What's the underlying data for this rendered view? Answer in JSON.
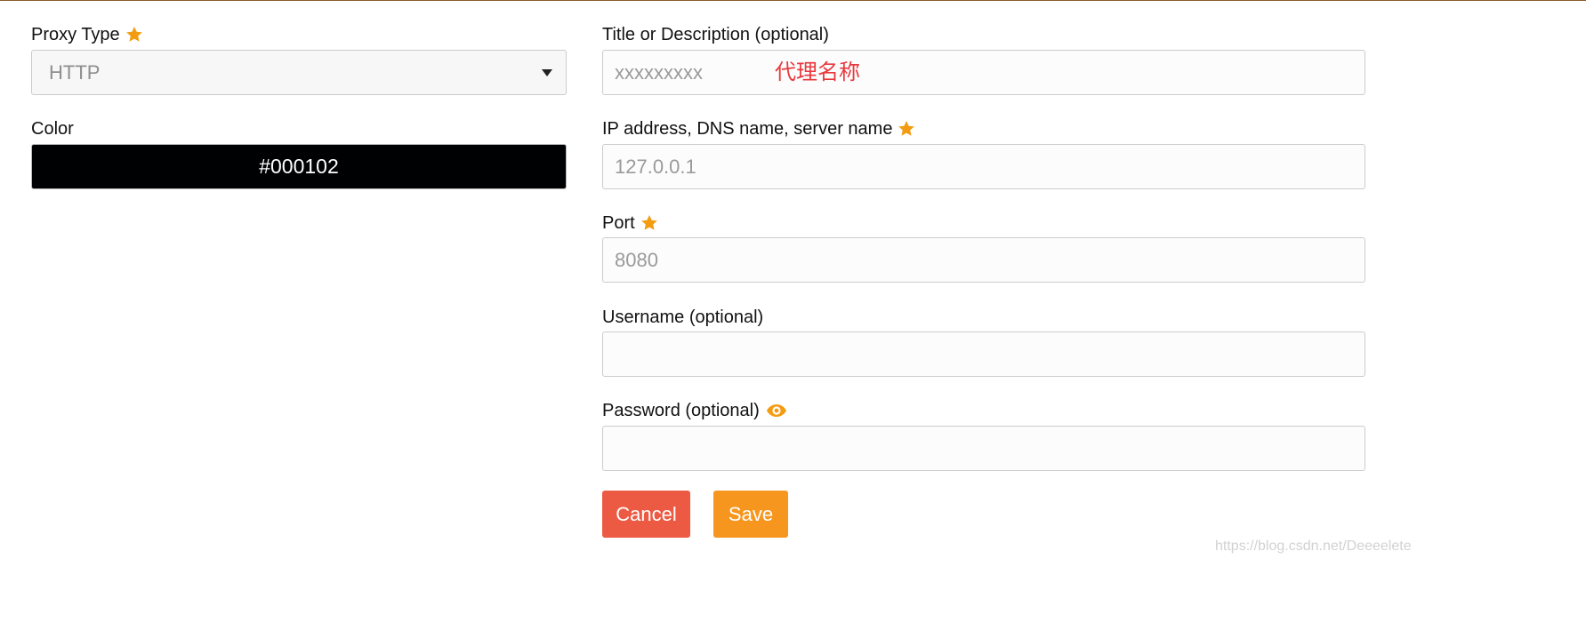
{
  "colors": {
    "required_star": "#f39c12",
    "cancel_button_bg": "#ec5a43",
    "save_button_bg": "#f7961e",
    "annotation_text": "#e8383d",
    "eye_icon": "#f39c12"
  },
  "left": {
    "proxy_type": {
      "label": "Proxy Type",
      "required_icon": "star-icon",
      "selected": "HTTP"
    },
    "color": {
      "label": "Color",
      "value": "#000102",
      "swatch": "#000102"
    }
  },
  "right": {
    "title": {
      "label": "Title or Description (optional)",
      "placeholder": "xxxxxxxxx",
      "value": "",
      "annotation": "代理名称"
    },
    "address": {
      "label": "IP address, DNS name, server name",
      "required_icon": "star-icon",
      "placeholder": "127.0.0.1",
      "value": ""
    },
    "port": {
      "label": "Port",
      "required_icon": "star-icon",
      "placeholder": "8080",
      "value": ""
    },
    "username": {
      "label": "Username (optional)",
      "placeholder": "",
      "value": ""
    },
    "password": {
      "label": "Password (optional)",
      "toggle_icon": "eye-icon",
      "placeholder": "",
      "value": ""
    }
  },
  "actions": {
    "cancel_label": "Cancel",
    "save_label": "Save"
  },
  "watermark": "https://blog.csdn.net/Deeeelete"
}
